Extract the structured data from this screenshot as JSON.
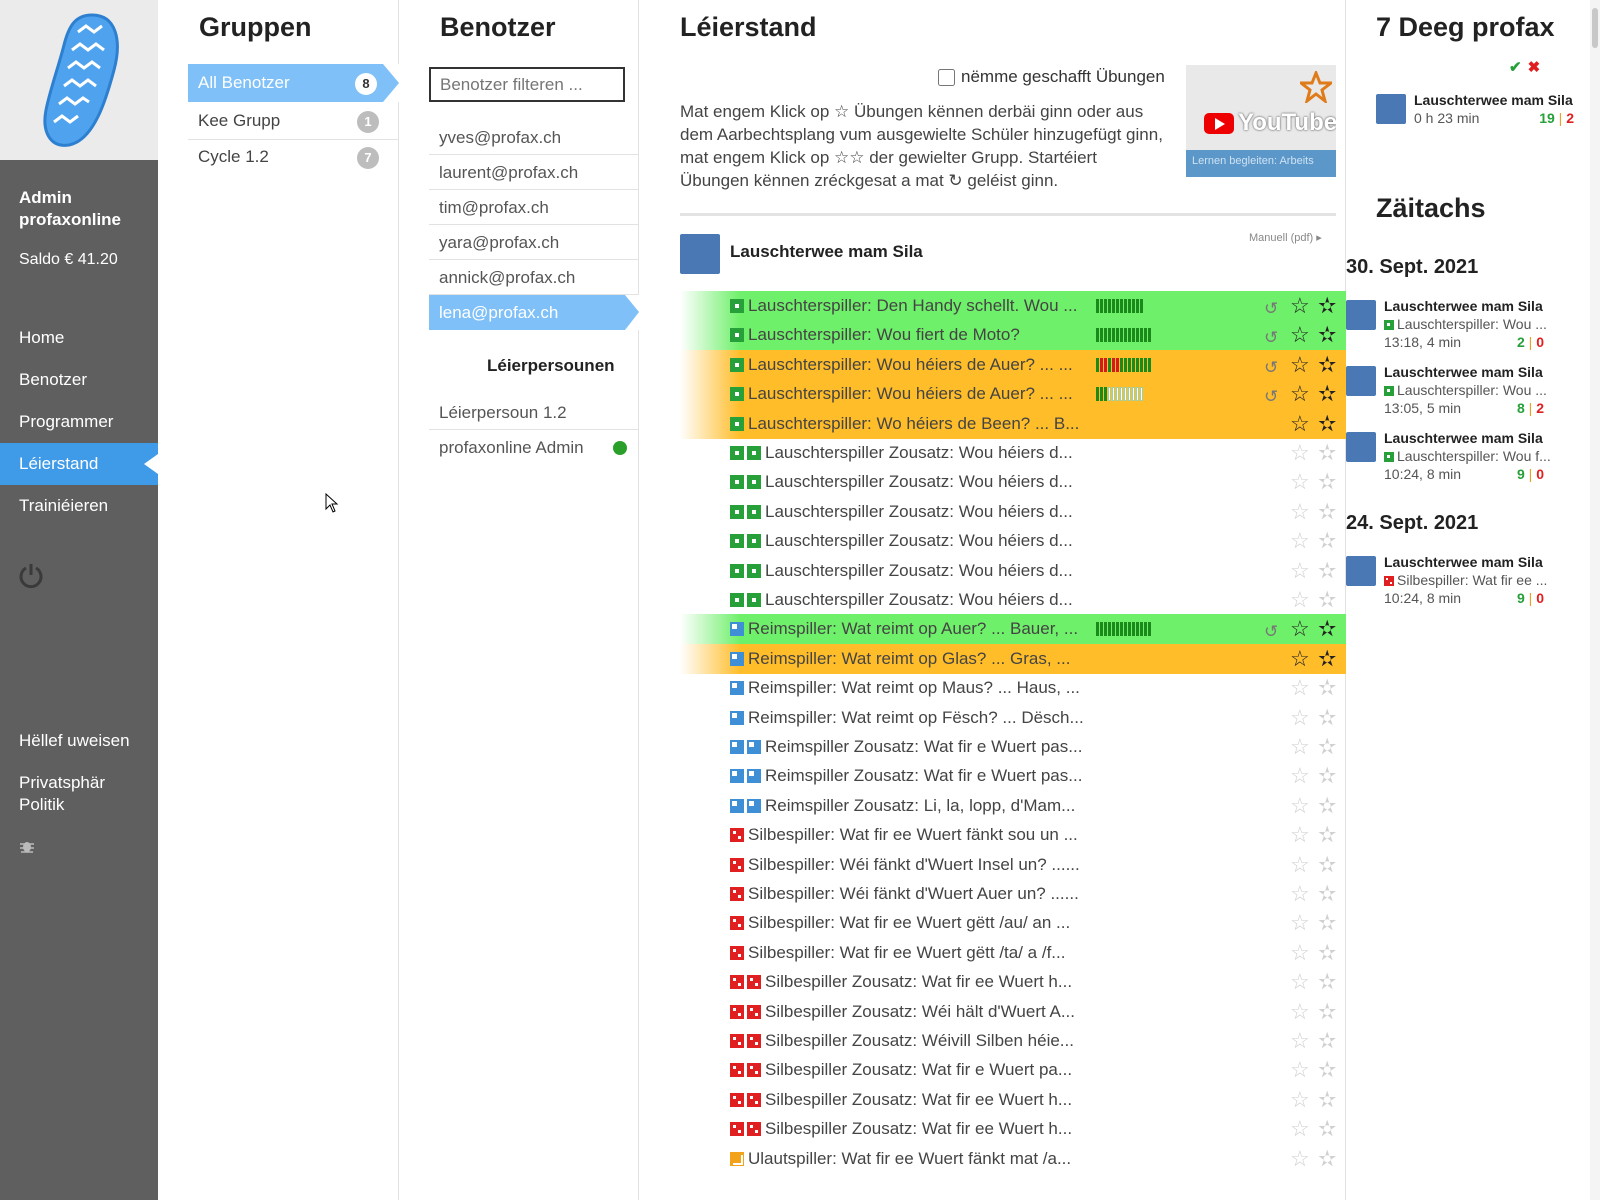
{
  "sidebar": {
    "user_name": "Admin profaxonline",
    "saldo": "Saldo € 41.20",
    "nav": [
      {
        "label": "Home"
      },
      {
        "label": "Benotzer"
      },
      {
        "label": "Programmer"
      },
      {
        "label": "Léierstand"
      },
      {
        "label": "Trainiéieren"
      }
    ],
    "help": "Hëllef uweisen",
    "privacy": "Privatsphär Politik"
  },
  "groups": {
    "title": "Gruppen",
    "items": [
      {
        "label": "All Benotzer",
        "count": "8"
      },
      {
        "label": "Kee Grupp",
        "count": "1"
      },
      {
        "label": "Cycle 1.2",
        "count": "7"
      }
    ]
  },
  "users": {
    "title": "Benotzer",
    "filter_placeholder": "Benotzer filteren ...",
    "items": [
      "yves@profax.ch",
      "laurent@profax.ch",
      "tim@profax.ch",
      "yara@profax.ch",
      "annick@profax.ch",
      "lena@profax.ch"
    ],
    "teachers_title": "Léierpersounen",
    "teachers": [
      "Léierpersoun 1.2",
      "profaxonline Admin"
    ]
  },
  "progress": {
    "title": "Léierstand",
    "only_done_label": "nëmme geschafft Übungen",
    "intro_1": "Mat engem Klick op ☆ Übungen kënnen derbäi ginn oder aus dem Aarbechtsplang vum ausgewielte Schüler hinzugefügt ginn, mat engem Klick op ☆☆ der gewielter Grupp. Startéiert Übungen kënnen zréckgesat a mat",
    "intro_2": "geléist ginn.",
    "video_text": "YouTube",
    "video_caption": "Lernen begleiten: Arbeits",
    "module_title": "Lauschterwee mam Sila",
    "manual": "Manuell (pdf) ▸",
    "exercises": [
      {
        "label": "Lauschterspiller: Den Handy schellt. Wou ...",
        "icons": [
          "g"
        ],
        "state": "green",
        "bars": "gggggggggggg",
        "reset": true,
        "s1": true,
        "s2": true
      },
      {
        "label": "Lauschterspiller: Wou fiert de Moto?",
        "icons": [
          "g"
        ],
        "state": "green",
        "bars": "gggggggggggggg",
        "reset": true,
        "s1": true,
        "s2": true
      },
      {
        "label": "Lauschterspiller: Wou héiers de Auer? ... ...",
        "icons": [
          "g"
        ],
        "state": "orange",
        "bars": "grrgrrgggggggg",
        "reset": true,
        "s1": true,
        "s2": true
      },
      {
        "label": "Lauschterspiller: Wou héiers de Auer? ... ...",
        "icons": [
          "g"
        ],
        "state": "orange",
        "bars": "gggeeeeeeeee",
        "reset": true,
        "s1": true,
        "s2": true
      },
      {
        "label": "Lauschterspiller: Wo héiers de Been? ... B...",
        "icons": [
          "g"
        ],
        "state": "orange",
        "bars": "",
        "reset": false,
        "s1": true,
        "s2": true
      },
      {
        "label": "Lauschterspiller Zousatz: Wou héiers d...",
        "icons": [
          "g",
          "g"
        ],
        "state": "",
        "bars": "",
        "reset": false,
        "s1": false,
        "s2": false
      },
      {
        "label": "Lauschterspiller Zousatz: Wou héiers d...",
        "icons": [
          "g",
          "g"
        ],
        "state": "",
        "bars": "",
        "reset": false,
        "s1": false,
        "s2": false
      },
      {
        "label": "Lauschterspiller Zousatz: Wou héiers d...",
        "icons": [
          "g",
          "g"
        ],
        "state": "",
        "bars": "",
        "reset": false,
        "s1": false,
        "s2": false
      },
      {
        "label": "Lauschterspiller Zousatz: Wou héiers d...",
        "icons": [
          "g",
          "g"
        ],
        "state": "",
        "bars": "",
        "reset": false,
        "s1": false,
        "s2": false
      },
      {
        "label": "Lauschterspiller Zousatz: Wou héiers d...",
        "icons": [
          "g",
          "g"
        ],
        "state": "",
        "bars": "",
        "reset": false,
        "s1": false,
        "s2": false
      },
      {
        "label": "Lauschterspiller Zousatz: Wou héiers d...",
        "icons": [
          "g",
          "g"
        ],
        "state": "",
        "bars": "",
        "reset": false,
        "s1": false,
        "s2": false
      },
      {
        "label": "Reimspiller: Wat reimt op Auer? ... Bauer, ...",
        "icons": [
          "b"
        ],
        "state": "green",
        "bars": "gggggggggggggg",
        "reset": true,
        "s1": true,
        "s2": true
      },
      {
        "label": "Reimspiller: Wat reimt op Glas? ... Gras, ...",
        "icons": [
          "b"
        ],
        "state": "orange",
        "bars": "",
        "reset": false,
        "s1": true,
        "s2": true
      },
      {
        "label": "Reimspiller: Wat reimt op Maus? ... Haus, ...",
        "icons": [
          "b"
        ],
        "state": "",
        "bars": "",
        "reset": false,
        "s1": false,
        "s2": false
      },
      {
        "label": "Reimspiller: Wat reimt op Fësch? ... Dësch...",
        "icons": [
          "b"
        ],
        "state": "",
        "bars": "",
        "reset": false,
        "s1": false,
        "s2": false
      },
      {
        "label": "Reimspiller Zousatz: Wat fir e Wuert pas...",
        "icons": [
          "b",
          "b"
        ],
        "state": "",
        "bars": "",
        "reset": false,
        "s1": false,
        "s2": false
      },
      {
        "label": "Reimspiller Zousatz: Wat fir e Wuert pas...",
        "icons": [
          "b",
          "b"
        ],
        "state": "",
        "bars": "",
        "reset": false,
        "s1": false,
        "s2": false
      },
      {
        "label": "Reimspiller Zousatz: Li, la, lopp, d'Mam...",
        "icons": [
          "b",
          "b"
        ],
        "state": "",
        "bars": "",
        "reset": false,
        "s1": false,
        "s2": false
      },
      {
        "label": "Silbespiller: Wat fir ee Wuert fänkt sou un ...",
        "icons": [
          "r"
        ],
        "state": "",
        "bars": "",
        "reset": false,
        "s1": false,
        "s2": false
      },
      {
        "label": "Silbespiller: Wéi fänkt d'Wuert Insel un? ......",
        "icons": [
          "r"
        ],
        "state": "",
        "bars": "",
        "reset": false,
        "s1": false,
        "s2": false
      },
      {
        "label": "Silbespiller: Wéi fänkt d'Wuert Auer un? ......",
        "icons": [
          "r"
        ],
        "state": "",
        "bars": "",
        "reset": false,
        "s1": false,
        "s2": false
      },
      {
        "label": "Silbespiller: Wat fir ee Wuert gëtt /au/ an ...",
        "icons": [
          "r"
        ],
        "state": "",
        "bars": "",
        "reset": false,
        "s1": false,
        "s2": false
      },
      {
        "label": "Silbespiller: Wat fir ee Wuert gëtt /ta/ a /f...",
        "icons": [
          "r"
        ],
        "state": "",
        "bars": "",
        "reset": false,
        "s1": false,
        "s2": false
      },
      {
        "label": "Silbespiller Zousatz: Wat fir ee Wuert h...",
        "icons": [
          "r",
          "r"
        ],
        "state": "",
        "bars": "",
        "reset": false,
        "s1": false,
        "s2": false
      },
      {
        "label": "Silbespiller Zousatz: Wéi hält d'Wuert A...",
        "icons": [
          "r",
          "r"
        ],
        "state": "",
        "bars": "",
        "reset": false,
        "s1": false,
        "s2": false
      },
      {
        "label": "Silbespiller Zousatz: Wéivill Silben héie...",
        "icons": [
          "r",
          "r"
        ],
        "state": "",
        "bars": "",
        "reset": false,
        "s1": false,
        "s2": false
      },
      {
        "label": "Silbespiller Zousatz: Wat fir e Wuert pa...",
        "icons": [
          "r",
          "r"
        ],
        "state": "",
        "bars": "",
        "reset": false,
        "s1": false,
        "s2": false
      },
      {
        "label": "Silbespiller Zousatz: Wat fir ee Wuert h...",
        "icons": [
          "r",
          "r"
        ],
        "state": "",
        "bars": "",
        "reset": false,
        "s1": false,
        "s2": false
      },
      {
        "label": "Silbespiller Zousatz: Wat fir ee Wuert h...",
        "icons": [
          "r",
          "r"
        ],
        "state": "",
        "bars": "",
        "reset": false,
        "s1": false,
        "s2": false
      },
      {
        "label": "Ulautspiller: Wat fir ee Wuert fänkt mat /a...",
        "icons": [
          "o"
        ],
        "state": "",
        "bars": "",
        "reset": false,
        "s1": false,
        "s2": false
      }
    ]
  },
  "right": {
    "title": "7 Deeg profax",
    "summary": {
      "title": "Lauschterwee mam Sila",
      "time": "0 h 23 min",
      "ok": "19",
      "no": "2"
    },
    "timeline_title": "Zäitachs",
    "days": [
      {
        "date": "30. Sept. 2021",
        "entries": [
          {
            "title": "Lauschterwee mam Sila",
            "icon": "g",
            "sub": "Lauschterspiller: Wou ...",
            "time": "13:18, 4 min",
            "ok": "2",
            "no": "0"
          },
          {
            "title": "Lauschterwee mam Sila",
            "icon": "g",
            "sub": "Lauschterspiller: Wou ...",
            "time": "13:05, 5 min",
            "ok": "8",
            "no": "2"
          },
          {
            "title": "Lauschterwee mam Sila",
            "icon": "g",
            "sub": "Lauschterspiller: Wou f...",
            "time": "10:24, 8 min",
            "ok": "9",
            "no": "0"
          }
        ]
      },
      {
        "date": "24. Sept. 2021",
        "entries": [
          {
            "title": "Lauschterwee mam Sila",
            "icon": "r",
            "sub": "Silbespiller: Wat fir ee ...",
            "time": "10:24, 8 min",
            "ok": "9",
            "no": "0"
          }
        ]
      }
    ]
  },
  "colors": {
    "accent": "#3f9ae8",
    "green_row": "#6ff06a",
    "orange_row": "#ffbd2a",
    "sidebar": "#5f5f5f"
  }
}
